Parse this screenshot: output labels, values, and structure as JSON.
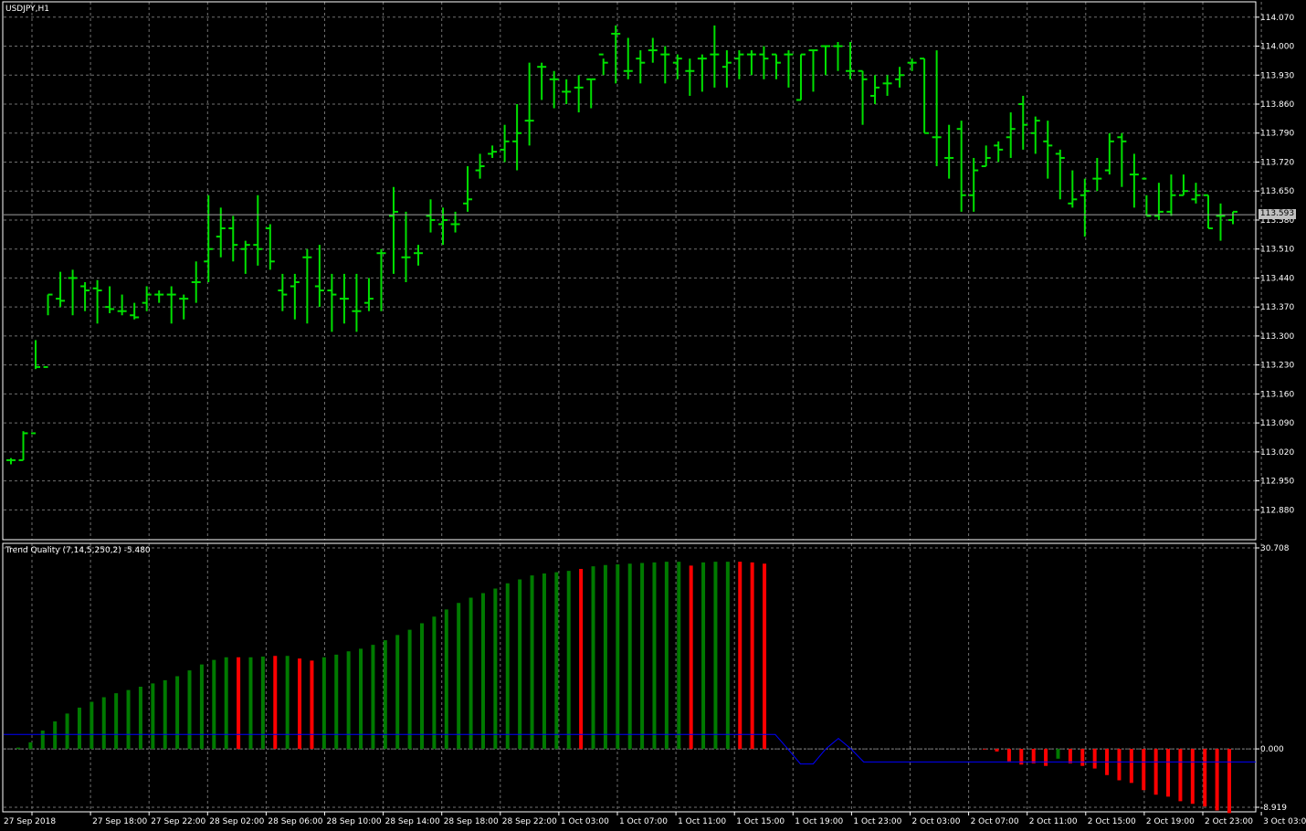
{
  "window": {
    "title": "USDJPY,H1",
    "indicator_title": "Trend Quality (7,14,5,250,2) -5.480",
    "current_price": "113.593"
  },
  "colors": {
    "background": "#000000",
    "grid": "#707070",
    "bar_up": "#00e000",
    "hist_green": "#007a00",
    "hist_red": "#ff0000",
    "signal_line": "#0000ff",
    "axis_text": "#ffffff"
  },
  "chart_data": [
    {
      "type": "ohlc",
      "symbol": "USDJPY",
      "timeframe": "H1",
      "ylim": [
        112.83,
        114.085
      ],
      "y_ticks": [
        "114.070",
        "114.000",
        "113.930",
        "113.860",
        "113.790",
        "113.720",
        "113.650",
        "113.580",
        "113.510",
        "113.440",
        "113.370",
        "113.300",
        "113.230",
        "113.160",
        "113.090",
        "113.020",
        "112.950",
        "112.880"
      ],
      "x_ticks": [
        "27 Sep 2018",
        "27 Sep 18:00",
        "27 Sep 22:00",
        "28 Sep 02:00",
        "28 Sep 06:00",
        "28 Sep 10:00",
        "28 Sep 14:00",
        "28 Sep 18:00",
        "28 Sep 22:00",
        "1 Oct 03:00",
        "1 Oct 07:00",
        "1 Oct 11:00",
        "1 Oct 15:00",
        "1 Oct 19:00",
        "1 Oct 23:00",
        "2 Oct 03:00",
        "2 Oct 07:00",
        "2 Oct 11:00",
        "2 Oct 15:00",
        "2 Oct 19:00",
        "2 Oct 23:00",
        "3 Oct 03:00"
      ],
      "bars": [
        [
          113.0,
          113.005,
          112.99,
          113.0
        ],
        [
          113.0,
          113.07,
          113.0,
          113.065
        ],
        [
          113.065,
          113.29,
          113.22,
          113.225
        ],
        [
          113.225,
          113.4,
          113.35,
          113.4
        ],
        [
          113.39,
          113.455,
          113.37,
          113.385
        ],
        [
          113.44,
          113.46,
          113.35,
          113.44
        ],
        [
          113.42,
          113.43,
          113.36,
          113.41
        ],
        [
          113.415,
          113.435,
          113.33,
          113.41
        ],
        [
          113.37,
          113.42,
          113.355,
          113.365
        ],
        [
          113.36,
          113.4,
          113.35,
          113.36
        ],
        [
          113.35,
          113.38,
          113.34,
          113.345
        ],
        [
          113.38,
          113.42,
          113.36,
          113.4
        ],
        [
          113.4,
          113.41,
          113.38,
          113.4
        ],
        [
          113.4,
          113.42,
          113.33,
          113.4
        ],
        [
          113.39,
          113.4,
          113.34,
          113.39
        ],
        [
          113.43,
          113.48,
          113.38,
          113.43
        ],
        [
          113.48,
          113.64,
          113.43,
          113.51
        ],
        [
          113.54,
          113.61,
          113.49,
          113.56
        ],
        [
          113.56,
          113.59,
          113.48,
          113.52
        ],
        [
          113.51,
          113.53,
          113.45,
          113.52
        ],
        [
          113.52,
          113.64,
          113.47,
          113.51
        ],
        [
          113.56,
          113.57,
          113.46,
          113.48
        ],
        [
          113.41,
          113.45,
          113.36,
          113.4
        ],
        [
          113.42,
          113.45,
          113.34,
          113.43
        ],
        [
          113.49,
          113.51,
          113.33,
          113.49
        ],
        [
          113.42,
          113.52,
          113.37,
          113.41
        ],
        [
          113.41,
          113.45,
          113.31,
          113.4
        ],
        [
          113.39,
          113.45,
          113.33,
          113.39
        ],
        [
          113.36,
          113.45,
          113.31,
          113.36
        ],
        [
          113.38,
          113.44,
          113.36,
          113.39
        ],
        [
          113.5,
          113.51,
          113.36,
          113.5
        ],
        [
          113.59,
          113.66,
          113.45,
          113.6
        ],
        [
          113.49,
          113.6,
          113.43,
          113.49
        ],
        [
          113.5,
          113.52,
          113.47,
          113.5
        ],
        [
          113.59,
          113.63,
          113.55,
          113.58
        ],
        [
          113.57,
          113.61,
          113.52,
          113.58
        ],
        [
          113.57,
          113.6,
          113.55,
          113.57
        ],
        [
          113.62,
          113.71,
          113.6,
          113.63
        ],
        [
          113.7,
          113.74,
          113.68,
          113.71
        ],
        [
          113.74,
          113.76,
          113.73,
          113.745
        ],
        [
          113.75,
          113.81,
          113.72,
          113.77
        ],
        [
          113.77,
          113.86,
          113.7,
          113.79
        ],
        [
          113.82,
          113.96,
          113.76,
          113.82
        ],
        [
          113.95,
          113.96,
          113.87,
          113.95
        ],
        [
          113.92,
          113.94,
          113.85,
          113.92
        ],
        [
          113.89,
          113.92,
          113.86,
          113.89
        ],
        [
          113.9,
          113.93,
          113.84,
          113.9
        ],
        [
          113.92,
          113.92,
          113.85,
          113.92
        ],
        [
          113.98,
          113.97,
          113.93,
          113.96
        ],
        [
          114.03,
          114.05,
          113.91,
          114.03
        ],
        [
          113.94,
          114.02,
          113.92,
          113.94
        ],
        [
          113.97,
          113.99,
          113.91,
          113.96
        ],
        [
          113.99,
          114.02,
          113.96,
          113.99
        ],
        [
          113.98,
          114.0,
          113.91,
          113.98
        ],
        [
          113.96,
          113.98,
          113.92,
          113.97
        ],
        [
          113.94,
          113.97,
          113.88,
          113.94
        ],
        [
          113.97,
          113.98,
          113.89,
          113.97
        ],
        [
          113.98,
          114.05,
          113.9,
          113.98
        ],
        [
          113.95,
          113.99,
          113.9,
          113.96
        ],
        [
          113.97,
          113.99,
          113.92,
          113.98
        ],
        [
          113.98,
          113.99,
          113.93,
          113.98
        ],
        [
          113.98,
          114.0,
          113.92,
          113.97
        ],
        [
          113.98,
          113.98,
          113.92,
          113.96
        ],
        [
          113.98,
          113.99,
          113.9,
          113.98
        ],
        [
          113.87,
          113.98,
          113.87,
          113.98
        ],
        [
          113.99,
          113.99,
          113.89,
          113.99
        ],
        [
          114.0,
          114.0,
          113.93,
          114.0
        ],
        [
          114.0,
          114.01,
          113.94,
          114.0
        ],
        [
          113.94,
          114.01,
          113.92,
          113.94
        ],
        [
          113.94,
          113.94,
          113.81,
          113.92
        ],
        [
          113.88,
          113.93,
          113.86,
          113.9
        ],
        [
          113.91,
          113.93,
          113.88,
          113.91
        ],
        [
          113.92,
          113.95,
          113.9,
          113.93
        ],
        [
          113.96,
          113.97,
          113.94,
          113.96
        ],
        [
          113.97,
          113.97,
          113.79,
          113.79
        ],
        [
          113.78,
          113.99,
          113.71,
          113.78
        ],
        [
          113.73,
          113.81,
          113.68,
          113.73
        ],
        [
          113.8,
          113.82,
          113.6,
          113.64
        ],
        [
          113.64,
          113.73,
          113.6,
          113.7
        ],
        [
          113.71,
          113.76,
          113.71,
          113.73
        ],
        [
          113.76,
          113.77,
          113.72,
          113.75
        ],
        [
          113.78,
          113.84,
          113.73,
          113.8
        ],
        [
          113.86,
          113.88,
          113.75,
          113.81
        ],
        [
          113.79,
          113.83,
          113.74,
          113.82
        ],
        [
          113.77,
          113.82,
          113.68,
          113.76
        ],
        [
          113.74,
          113.75,
          113.63,
          113.73
        ],
        [
          113.62,
          113.7,
          113.61,
          113.63
        ],
        [
          113.64,
          113.68,
          113.54,
          113.65
        ],
        [
          113.68,
          113.73,
          113.65,
          113.68
        ],
        [
          113.7,
          113.79,
          113.69,
          113.77
        ],
        [
          113.78,
          113.79,
          113.66,
          113.77
        ],
        [
          113.69,
          113.74,
          113.61,
          113.69
        ],
        [
          113.68,
          113.64,
          113.59,
          113.59
        ],
        [
          113.59,
          113.67,
          113.58,
          113.6
        ],
        [
          113.6,
          113.69,
          113.59,
          113.64
        ],
        [
          113.64,
          113.69,
          113.64,
          113.65
        ],
        [
          113.63,
          113.67,
          113.62,
          113.64
        ],
        [
          113.64,
          113.64,
          113.56,
          113.56
        ],
        [
          113.59,
          113.62,
          113.53,
          113.59
        ],
        [
          113.58,
          113.6,
          113.57,
          113.6
        ]
      ]
    },
    {
      "type": "bar",
      "name": "Trend Quality (7,14,5,250,2)",
      "ylim": [
        -8.919,
        30.708
      ],
      "y_ticks": [
        "30.708",
        "0.000",
        "-8.919"
      ],
      "zero_line": 0,
      "histogram": [
        {
          "v": 0.2,
          "c": "green"
        },
        {
          "v": 1.0,
          "c": "green"
        },
        {
          "v": 2.8,
          "c": "green"
        },
        {
          "v": 4.2,
          "c": "green"
        },
        {
          "v": 5.4,
          "c": "green"
        },
        {
          "v": 6.3,
          "c": "green"
        },
        {
          "v": 7.2,
          "c": "green"
        },
        {
          "v": 7.9,
          "c": "green"
        },
        {
          "v": 8.5,
          "c": "green"
        },
        {
          "v": 9.0,
          "c": "green"
        },
        {
          "v": 9.5,
          "c": "green"
        },
        {
          "v": 10.0,
          "c": "green"
        },
        {
          "v": 10.5,
          "c": "green"
        },
        {
          "v": 11.1,
          "c": "green"
        },
        {
          "v": 12.0,
          "c": "green"
        },
        {
          "v": 12.9,
          "c": "green"
        },
        {
          "v": 13.6,
          "c": "green"
        },
        {
          "v": 14.0,
          "c": "green"
        },
        {
          "v": 14.0,
          "c": "red"
        },
        {
          "v": 14.0,
          "c": "green"
        },
        {
          "v": 14.1,
          "c": "green"
        },
        {
          "v": 14.2,
          "c": "red"
        },
        {
          "v": 14.2,
          "c": "green"
        },
        {
          "v": 13.8,
          "c": "red"
        },
        {
          "v": 13.5,
          "c": "red"
        },
        {
          "v": 14.0,
          "c": "green"
        },
        {
          "v": 14.4,
          "c": "green"
        },
        {
          "v": 14.9,
          "c": "green"
        },
        {
          "v": 15.3,
          "c": "green"
        },
        {
          "v": 15.9,
          "c": "green"
        },
        {
          "v": 16.6,
          "c": "green"
        },
        {
          "v": 17.4,
          "c": "green"
        },
        {
          "v": 18.2,
          "c": "green"
        },
        {
          "v": 19.2,
          "c": "green"
        },
        {
          "v": 20.2,
          "c": "green"
        },
        {
          "v": 21.3,
          "c": "green"
        },
        {
          "v": 22.3,
          "c": "green"
        },
        {
          "v": 23.1,
          "c": "green"
        },
        {
          "v": 23.8,
          "c": "green"
        },
        {
          "v": 24.5,
          "c": "green"
        },
        {
          "v": 25.3,
          "c": "green"
        },
        {
          "v": 25.9,
          "c": "green"
        },
        {
          "v": 26.5,
          "c": "green"
        },
        {
          "v": 26.8,
          "c": "green"
        },
        {
          "v": 27.0,
          "c": "green"
        },
        {
          "v": 27.2,
          "c": "green"
        },
        {
          "v": 27.5,
          "c": "red"
        },
        {
          "v": 27.9,
          "c": "green"
        },
        {
          "v": 28.1,
          "c": "green"
        },
        {
          "v": 28.2,
          "c": "green"
        },
        {
          "v": 28.3,
          "c": "green"
        },
        {
          "v": 28.4,
          "c": "green"
        },
        {
          "v": 28.5,
          "c": "green"
        },
        {
          "v": 28.6,
          "c": "green"
        },
        {
          "v": 28.6,
          "c": "green"
        },
        {
          "v": 28.0,
          "c": "red"
        },
        {
          "v": 28.5,
          "c": "green"
        },
        {
          "v": 28.6,
          "c": "green"
        },
        {
          "v": 28.6,
          "c": "green"
        },
        {
          "v": 28.6,
          "c": "red"
        },
        {
          "v": 28.5,
          "c": "red"
        },
        {
          "v": 28.3,
          "c": "red"
        },
        {
          "v": 0.0,
          "c": "green"
        },
        {
          "v": 0.0,
          "c": "green"
        },
        {
          "v": 0.0,
          "c": "green"
        },
        {
          "v": 0.0,
          "c": "green"
        },
        {
          "v": 0.0,
          "c": "green"
        },
        {
          "v": 0.0,
          "c": "green"
        },
        {
          "v": 0.0,
          "c": "green"
        },
        {
          "v": 0.0,
          "c": "green"
        },
        {
          "v": 0.0,
          "c": "green"
        },
        {
          "v": 0.0,
          "c": "green"
        },
        {
          "v": 0.0,
          "c": "green"
        },
        {
          "v": 0.0,
          "c": "green"
        },
        {
          "v": 0.0,
          "c": "green"
        },
        {
          "v": 0.0,
          "c": "green"
        },
        {
          "v": 0.0,
          "c": "green"
        },
        {
          "v": 0.0,
          "c": "green"
        },
        {
          "v": 0.0,
          "c": "green"
        },
        {
          "v": -0.1,
          "c": "red"
        },
        {
          "v": -0.4,
          "c": "red"
        },
        {
          "v": -1.9,
          "c": "red"
        },
        {
          "v": -2.4,
          "c": "red"
        },
        {
          "v": -2.2,
          "c": "red"
        },
        {
          "v": -2.6,
          "c": "red"
        },
        {
          "v": -1.5,
          "c": "green"
        },
        {
          "v": -2.2,
          "c": "red"
        },
        {
          "v": -2.6,
          "c": "red"
        },
        {
          "v": -3.0,
          "c": "red"
        },
        {
          "v": -4.0,
          "c": "red"
        },
        {
          "v": -4.8,
          "c": "red"
        },
        {
          "v": -5.2,
          "c": "red"
        },
        {
          "v": -6.3,
          "c": "red"
        },
        {
          "v": -7.0,
          "c": "red"
        },
        {
          "v": -7.3,
          "c": "red"
        },
        {
          "v": -8.0,
          "c": "red"
        },
        {
          "v": -8.4,
          "c": "red"
        },
        {
          "v": -8.8,
          "c": "red"
        },
        {
          "v": -9.4,
          "c": "red"
        },
        {
          "v": -9.8,
          "c": "red"
        }
      ],
      "signal_line": [
        2.2,
        2.2,
        2.2,
        2.2,
        2.2,
        2.2,
        2.2,
        2.2,
        2.2,
        2.2,
        2.2,
        2.2,
        2.2,
        2.2,
        2.2,
        2.2,
        2.2,
        2.2,
        2.2,
        2.2,
        2.2,
        2.2,
        2.2,
        2.2,
        2.2,
        2.2,
        2.2,
        2.2,
        2.2,
        2.2,
        2.2,
        2.2,
        2.2,
        2.2,
        2.2,
        2.2,
        2.2,
        2.2,
        2.2,
        2.2,
        2.2,
        2.2,
        2.2,
        2.2,
        2.2,
        2.2,
        2.2,
        2.2,
        2.2,
        2.2,
        2.2,
        2.2,
        2.2,
        2.2,
        2.2,
        2.2,
        2.2,
        2.2,
        2.2,
        2.2,
        2.2,
        2.2,
        0.0,
        -2.3,
        -2.3,
        0.0,
        1.6,
        0.0,
        -2.0,
        -2.0,
        -2.0,
        -2.0,
        -2.0,
        -2.0,
        -2.0,
        -2.0,
        -2.0,
        -2.0,
        -2.0,
        -2.0,
        -2.0,
        -2.0,
        -2.0,
        -2.0,
        -2.0,
        -2.0,
        -2.0,
        -2.0,
        -2.0,
        -2.0,
        -2.0,
        -2.0,
        -2.0,
        -2.0,
        -2.0,
        -2.0,
        -2.0,
        -2.0,
        -2.0,
        -2.0
      ]
    }
  ]
}
